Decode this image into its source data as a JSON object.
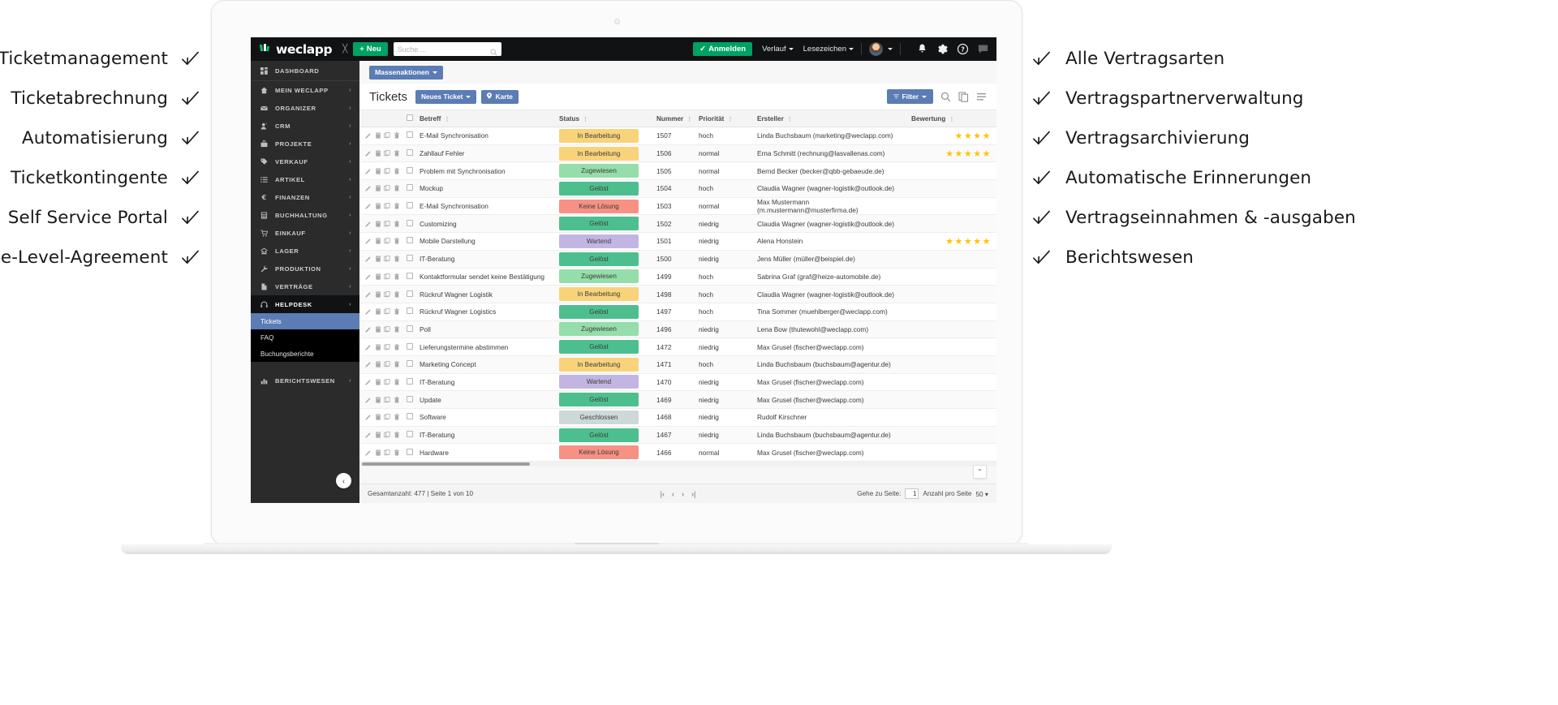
{
  "left_features": [
    {
      "label": "Ticketmanagement",
      "icon": "check-icon"
    },
    {
      "label": "Ticketabrechnung",
      "icon": "check-icon"
    },
    {
      "label": "Automatisierung",
      "icon": "check-icon"
    },
    {
      "label": "Ticketkontingente",
      "icon": "check-icon"
    },
    {
      "label": "Self Service Portal",
      "icon": "check-icon"
    },
    {
      "label": "Service-Level-Agreement",
      "icon": "check-icon"
    }
  ],
  "right_features": [
    {
      "label": "Alle Vertragsarten",
      "icon": "check-icon"
    },
    {
      "label": "Vertragspartnerverwaltung",
      "icon": "check-icon"
    },
    {
      "label": "Vertragsarchivierung",
      "icon": "check-icon"
    },
    {
      "label": "Automatische Erinnerungen",
      "icon": "check-icon"
    },
    {
      "label": "Vertragseinnahmen & -ausgaben",
      "icon": "check-icon"
    },
    {
      "label": "Berichtswesen",
      "icon": "check-icon"
    }
  ],
  "topbar": {
    "logo_text": "weclapp",
    "collapse_glyph": "╳",
    "new_button": "Neu",
    "new_plus": "+",
    "search_placeholder": "Suche ...",
    "search_value": "",
    "login_button": "Anmelden",
    "login_check": "✓",
    "history_link": "Verlauf",
    "bookmarks_link": "Lesezeichen",
    "icons": [
      "bell-icon",
      "gear-icon",
      "help-icon",
      "chat-icon"
    ]
  },
  "sidebar": {
    "dashboard": "DASHBOARD",
    "items": [
      {
        "label": "MEIN WECLAPP",
        "icon": "home-icon"
      },
      {
        "label": "ORGANIZER",
        "icon": "envelope-icon"
      },
      {
        "label": "CRM",
        "icon": "person-icon"
      },
      {
        "label": "PROJEKTE",
        "icon": "briefcase-icon"
      },
      {
        "label": "VERKAUF",
        "icon": "tag-icon"
      },
      {
        "label": "ARTIKEL",
        "icon": "list-icon"
      },
      {
        "label": "FINANZEN",
        "icon": "euro-icon"
      },
      {
        "label": "BUCHHALTUNG",
        "icon": "calculator-icon"
      },
      {
        "label": "EINKAUF",
        "icon": "cart-icon"
      },
      {
        "label": "LAGER",
        "icon": "warehouse-icon"
      },
      {
        "label": "PRODUKTION",
        "icon": "wrench-icon"
      },
      {
        "label": "VERTRÄGE",
        "icon": "document-icon"
      },
      {
        "label": "HELPDESK",
        "icon": "headset-icon",
        "active": true
      }
    ],
    "helpdesk_subitems": [
      {
        "label": "Tickets",
        "selected": true
      },
      {
        "label": "FAQ",
        "selected": false
      },
      {
        "label": "Buchungsberichte",
        "selected": false
      }
    ],
    "bottom_items": [
      {
        "label": "BERICHTSWESEN",
        "icon": "bar-chart-icon"
      }
    ],
    "collapse_glyph": "‹"
  },
  "toolbar": {
    "bulk_actions": "Massenaktionen",
    "page_title": "Tickets",
    "new_ticket": "Neues Ticket",
    "map_button": "Karte",
    "filter_button": "Filter",
    "right_icons": [
      "search-icon",
      "copy-icon",
      "columns-icon"
    ]
  },
  "table": {
    "columns": [
      "Betreff",
      "Status",
      "Nummer",
      "Priorität",
      "Ersteller",
      "Bewertung"
    ],
    "row_action_icons": [
      "pencil-icon",
      "duplicate-icon",
      "copy-icon",
      "trash-icon"
    ],
    "status_colors": {
      "In Bearbeitung": "#f8d37a",
      "Zugewiesen": "#95ddaa",
      "Gelöst": "#4dbf8e",
      "Keine Lösung": "#f79183",
      "Wartend": "#c3b5e2",
      "Geschlossen": "#cdd9d7"
    },
    "star_color": "#fcc400",
    "rows": [
      {
        "betreff": "E-Mail Synchronisation",
        "status": "In Bearbeitung",
        "nummer": "1507",
        "prioritaet": "hoch",
        "ersteller": "Linda Buchsbaum (marketing@weclapp.com)",
        "bewertung": 4
      },
      {
        "betreff": "Zahllauf Fehler",
        "status": "In Bearbeitung",
        "nummer": "1506",
        "prioritaet": "normal",
        "ersteller": "Erna Schmitt (rechnung@lasvallenas.com)",
        "bewertung": 5
      },
      {
        "betreff": "Problem mit Synchronisation",
        "status": "Zugewiesen",
        "nummer": "1505",
        "prioritaet": "normal",
        "ersteller": "Bernd Becker (becker@qbb-gebaeude.de)",
        "bewertung": 0
      },
      {
        "betreff": "Mockup",
        "status": "Gelöst",
        "nummer": "1504",
        "prioritaet": "hoch",
        "ersteller": "Claudia Wagner (wagner-logistik@outlook.de)",
        "bewertung": 0
      },
      {
        "betreff": "E-Mail Synchronisation",
        "status": "Keine Lösung",
        "nummer": "1503",
        "prioritaet": "normal",
        "ersteller": "Max Mustermann (m.mustermann@musterfirma.de)",
        "bewertung": 0
      },
      {
        "betreff": "Customizing",
        "status": "Gelöst",
        "nummer": "1502",
        "prioritaet": "niedrig",
        "ersteller": "Claudia Wagner (wagner-logistik@outlook.de)",
        "bewertung": 0
      },
      {
        "betreff": "Mobile Darstellung",
        "status": "Wartend",
        "nummer": "1501",
        "prioritaet": "niedrig",
        "ersteller": "Alena Honstein",
        "bewertung": 5
      },
      {
        "betreff": "IT-Beratung",
        "status": "Gelöst",
        "nummer": "1500",
        "prioritaet": "niedrig",
        "ersteller": "Jens Müller (müller@beispiel.de)",
        "bewertung": 0
      },
      {
        "betreff": "Kontaktformular sendet keine Bestätigung",
        "status": "Zugewiesen",
        "nummer": "1499",
        "prioritaet": "hoch",
        "ersteller": "Sabrina Graf (graf@heize-automobile.de)",
        "bewertung": 0
      },
      {
        "betreff": "Rückruf Wagner Logistik",
        "status": "In Bearbeitung",
        "nummer": "1498",
        "prioritaet": "hoch",
        "ersteller": "Claudia Wagner (wagner-logistik@outlook.de)",
        "bewertung": 0
      },
      {
        "betreff": "Rückruf Wagner Logistics",
        "status": "Gelöst",
        "nummer": "1497",
        "prioritaet": "hoch",
        "ersteller": "Tina Sommer (muehlberger@weclapp.com)",
        "bewertung": 0
      },
      {
        "betreff": "Poll",
        "status": "Zugewiesen",
        "nummer": "1496",
        "prioritaet": "niedrig",
        "ersteller": "Lena Bow (thutewohl@weclapp.com)",
        "bewertung": 0
      },
      {
        "betreff": "Lieferungstermine abstimmen",
        "status": "Gelöst",
        "nummer": "1472",
        "prioritaet": "niedrig",
        "ersteller": "Max Grusel (fischer@weclapp.com)",
        "bewertung": 0
      },
      {
        "betreff": "Marketing Concept",
        "status": "In Bearbeitung",
        "nummer": "1471",
        "prioritaet": "hoch",
        "ersteller": "Linda Buchsbaum (buchsbaum@agentur.de)",
        "bewertung": 0
      },
      {
        "betreff": "IT-Beratung",
        "status": "Wartend",
        "nummer": "1470",
        "prioritaet": "niedrig",
        "ersteller": "Max Grusel (fischer@weclapp.com)",
        "bewertung": 0
      },
      {
        "betreff": "Update",
        "status": "Gelöst",
        "nummer": "1469",
        "prioritaet": "niedrig",
        "ersteller": "Max Grusel (fischer@weclapp.com)",
        "bewertung": 0
      },
      {
        "betreff": "Software",
        "status": "Geschlossen",
        "nummer": "1468",
        "prioritaet": "niedrig",
        "ersteller": "Rudolf Kirschner",
        "bewertung": 0
      },
      {
        "betreff": "IT-Beratung",
        "status": "Gelöst",
        "nummer": "1467",
        "prioritaet": "niedrig",
        "ersteller": "Linda Buchsbaum (buchsbaum@agentur.de)",
        "bewertung": 0
      },
      {
        "betreff": "Hardware",
        "status": "Keine Lösung",
        "nummer": "1466",
        "prioritaet": "normal",
        "ersteller": "Max Grusel (fischer@weclapp.com)",
        "bewertung": 0
      }
    ]
  },
  "footer": {
    "summary": "Gesamtanzahl: 477 | Seite 1 von 10",
    "nav": [
      "|‹",
      "‹",
      "›",
      "›|"
    ],
    "goto_label": "Gehe zu Seite:",
    "page_value": "1",
    "per_page_label": "Anzahl pro Seite",
    "per_page_value": "50",
    "scroll_top_glyph": "⌃"
  }
}
